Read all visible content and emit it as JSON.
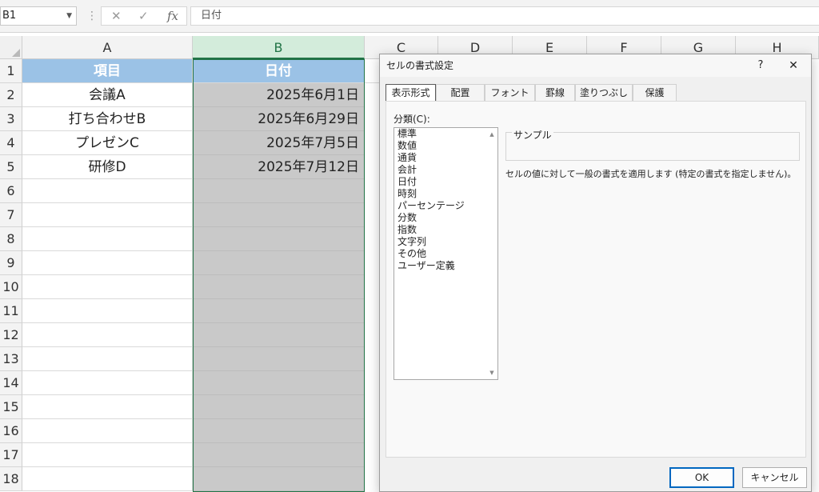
{
  "formula_bar": {
    "name_box": "B1",
    "separator": "⋮",
    "cancel_glyph": "✕",
    "enter_glyph": "✓",
    "fx_glyph": "fx",
    "content": "日付"
  },
  "columns": [
    "A",
    "B",
    "C",
    "D",
    "E",
    "F",
    "G",
    "H"
  ],
  "rows": [
    "1",
    "2",
    "3",
    "4",
    "5",
    "6",
    "7",
    "8",
    "9",
    "10",
    "11",
    "12",
    "13",
    "14",
    "15",
    "16",
    "17",
    "18"
  ],
  "table": {
    "header_a": "項目",
    "header_b": "日付",
    "items": [
      {
        "a": "会議A",
        "b": "2025年6月1日"
      },
      {
        "a": "打ち合わせB",
        "b": "2025年6月29日"
      },
      {
        "a": "プレゼンC",
        "b": "2025年7月5日"
      },
      {
        "a": "研修D",
        "b": "2025年7月12日"
      }
    ]
  },
  "dialog": {
    "title": "セルの書式設定",
    "help": "?",
    "close": "✕",
    "tabs": [
      "表示形式",
      "配置",
      "フォント",
      "罫線",
      "塗りつぶし",
      "保護"
    ],
    "category_label": "分類(C):",
    "categories": [
      "標準",
      "数値",
      "通貨",
      "会計",
      "日付",
      "時刻",
      "パーセンテージ",
      "分数",
      "指数",
      "文字列",
      "その他",
      "ユーザー定義"
    ],
    "sample_label": "サンプル",
    "description": "セルの値に対して一般の書式を適用します (特定の書式を指定しません)。",
    "ok": "OK",
    "cancel": "キャンセル"
  },
  "colors": {
    "header_fill": "#9bc2e6",
    "selection_fill": "#c9c9c9",
    "selection_border": "#217346"
  }
}
